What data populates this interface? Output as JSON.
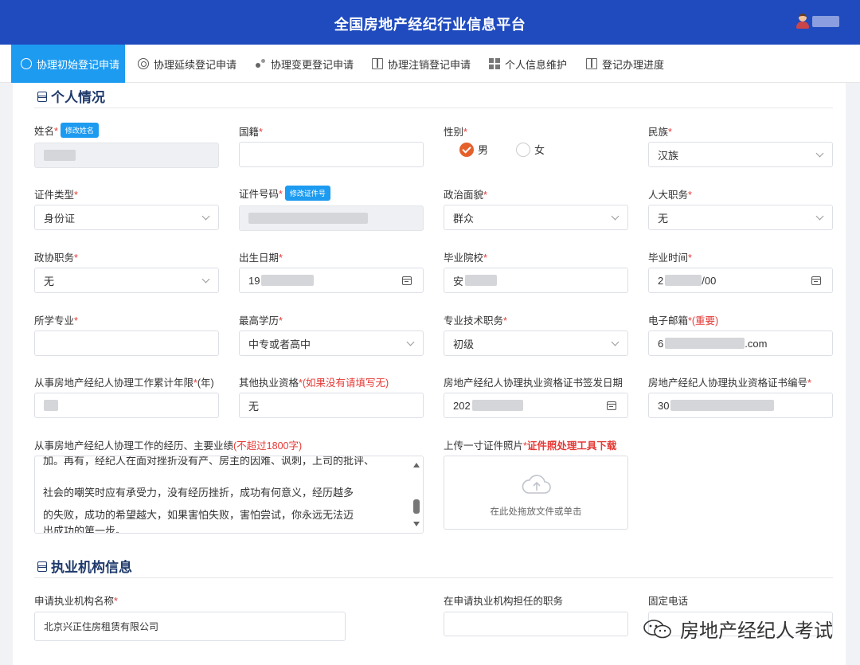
{
  "header": {
    "title": "全国房地产经纪行业信息平台",
    "user_icon": "user-avatar-icon"
  },
  "nav": {
    "tabs": [
      {
        "label": "协理初始登记申请",
        "icon": "clock-icon",
        "active": true
      },
      {
        "label": "协理延续登记申请",
        "icon": "target-icon",
        "active": false
      },
      {
        "label": "协理变更登记申请",
        "icon": "dots-icon",
        "active": false
      },
      {
        "label": "协理注销登记申请",
        "icon": "book-icon",
        "active": false
      },
      {
        "label": "个人信息维护",
        "icon": "grid-icon",
        "active": false
      },
      {
        "label": "登记办理进度",
        "icon": "book-icon",
        "active": false
      }
    ]
  },
  "personal": {
    "section_title": "个人情况",
    "name": {
      "label": "姓名",
      "star": "*",
      "btn": "修改姓名"
    },
    "nationality": {
      "label": "国籍",
      "star": "*",
      "value": ""
    },
    "gender": {
      "label": "性别",
      "star": "*",
      "male": "男",
      "female": "女",
      "selected": "男"
    },
    "ethnicity": {
      "label": "民族",
      "star": "*",
      "value": "汉族"
    },
    "id_type": {
      "label": "证件类型",
      "star": "*",
      "value": "身份证"
    },
    "id_number": {
      "label": "证件号码",
      "star": "*",
      "btn": "修改证件号"
    },
    "political": {
      "label": "政治面貌",
      "star": "*",
      "value": "群众"
    },
    "npc_post": {
      "label": "人大职务",
      "star": "*",
      "value": "无"
    },
    "cppcc_post": {
      "label": "政协职务",
      "star": "*",
      "value": "无"
    },
    "birth_date": {
      "label": "出生日期",
      "star": "*",
      "value_prefix": "19"
    },
    "school": {
      "label": "毕业院校",
      "star": "*",
      "value_prefix": "安"
    },
    "grad_time": {
      "label": "毕业时间",
      "star": "*",
      "value_prefix": "2",
      "value_suffix": "/00"
    },
    "major": {
      "label": "所学专业",
      "star": "*",
      "value": ""
    },
    "education": {
      "label": "最高学历",
      "star": "*",
      "value": "中专或者高中"
    },
    "tech_title": {
      "label": "专业技术职务",
      "star": "*",
      "value": "初级"
    },
    "email": {
      "label": "电子邮箱",
      "star": "*",
      "note": "(重要)",
      "value_prefix": "6",
      "value_suffix": ".com"
    },
    "years": {
      "label": "从事房地产经纪人协理工作累计年限",
      "star": "*",
      "suffix": "(年)"
    },
    "other_qual": {
      "label": "其他执业资格",
      "star": "*",
      "note": "(如果没有请填写无)",
      "value": "无"
    },
    "cert_date": {
      "label": "房地产经纪人协理执业资格证书签发日期",
      "value_prefix": "202"
    },
    "cert_no": {
      "label": "房地产经纪人协理执业资格证书编号",
      "star": "*",
      "value_prefix": "30"
    },
    "experience": {
      "label": "从事房地产经纪人协理工作的经历、主要业绩",
      "note": "(不超过1800字)",
      "lines": [
        "加。再有，经纪人在面对挫折没有产、房主的因难、讽刺，上司的批评、",
        "社会的嘲笑时应有承受力，没有经历挫折，成功有何意义，经历越多",
        "的失败，成功的希望越大，如果害怕失败，害怕尝试，你永远无法迈",
        "出成功的第一步。"
      ]
    },
    "photo": {
      "label": "上传一寸证件照片",
      "star": "*",
      "tool_link": "证件照处理工具下载",
      "drop_text": "在此处拖放文件或单击"
    }
  },
  "org": {
    "section_title": "执业机构信息",
    "org_name": {
      "label": "申请执业机构名称",
      "star": "*",
      "value": "北京兴正住房租赁有限公司"
    },
    "position": {
      "label": "在申请执业机构担任的职务",
      "value": ""
    },
    "phone": {
      "label": "固定电话",
      "value": ""
    }
  },
  "watermark": {
    "text": "房地产经纪人考试"
  },
  "colors": {
    "header_bg": "#1f4bbf",
    "active_tab": "#1d9bf0",
    "required": "#e53935",
    "radio_checked": "#e5602a"
  }
}
